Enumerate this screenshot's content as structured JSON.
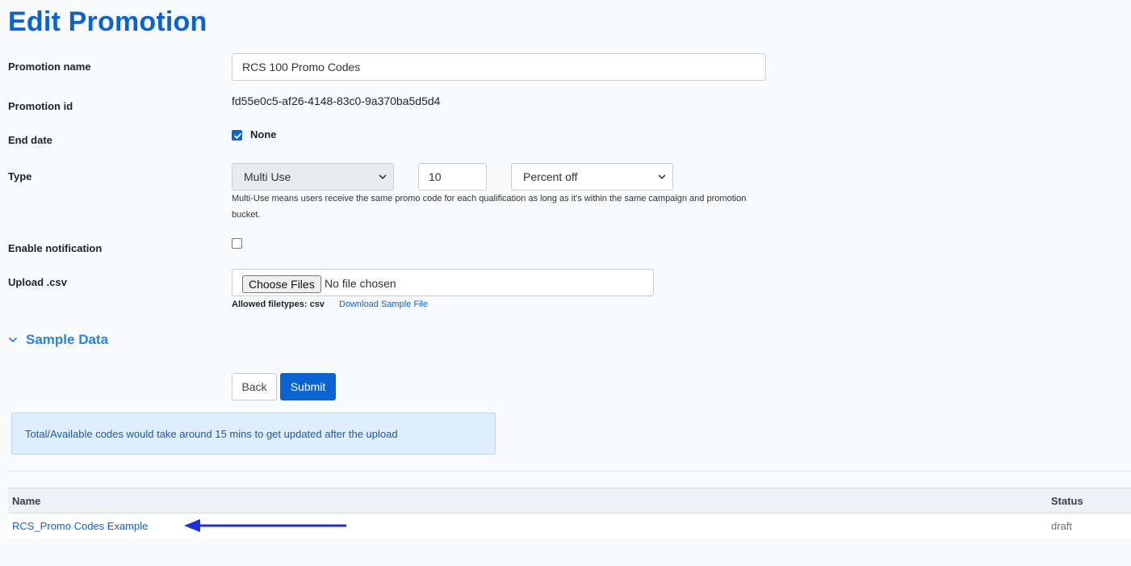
{
  "page": {
    "title": "Edit Promotion"
  },
  "form": {
    "promotion_name": {
      "label": "Promotion name",
      "value": "RCS 100 Promo Codes"
    },
    "promotion_id": {
      "label": "Promotion id",
      "value": "fd55e0c5-af26-4148-83c0-9a370ba5d5d4"
    },
    "end_date": {
      "label": "End date",
      "checkbox_label": "None",
      "checked": true
    },
    "type": {
      "label": "Type",
      "use_select": "Multi Use",
      "amount": "10",
      "discount_select": "Percent off",
      "help": "Multi-Use means users receive the same promo code for each qualification as long as it's within the same campaign and promotion bucket."
    },
    "enable_notification": {
      "label": "Enable notification",
      "checked": false
    },
    "upload_csv": {
      "label": "Upload .csv",
      "choose_button": "Choose Files",
      "file_status": "No file chosen",
      "allowed_types": "Allowed filetypes: csv",
      "download_link": "Download Sample File"
    }
  },
  "sample_data": {
    "label": "Sample Data"
  },
  "actions": {
    "back_label": "Back",
    "submit_label": "Submit"
  },
  "info": {
    "message": "Total/Available codes would take around 15 mins to get updated after the upload"
  },
  "table": {
    "columns": [
      "Name",
      "Status"
    ],
    "rows": [
      {
        "name": "RCS_Promo Codes Example",
        "status": "draft"
      }
    ]
  },
  "colors": {
    "primary": "#0b63d1",
    "info_bg": "#deeefd",
    "arrow": "#1a2fe0"
  },
  "icons": {
    "accordion": "chevron-down-icon",
    "select": "chevron-down-icon",
    "check": "check-icon",
    "annotation": "arrow-left-icon"
  }
}
